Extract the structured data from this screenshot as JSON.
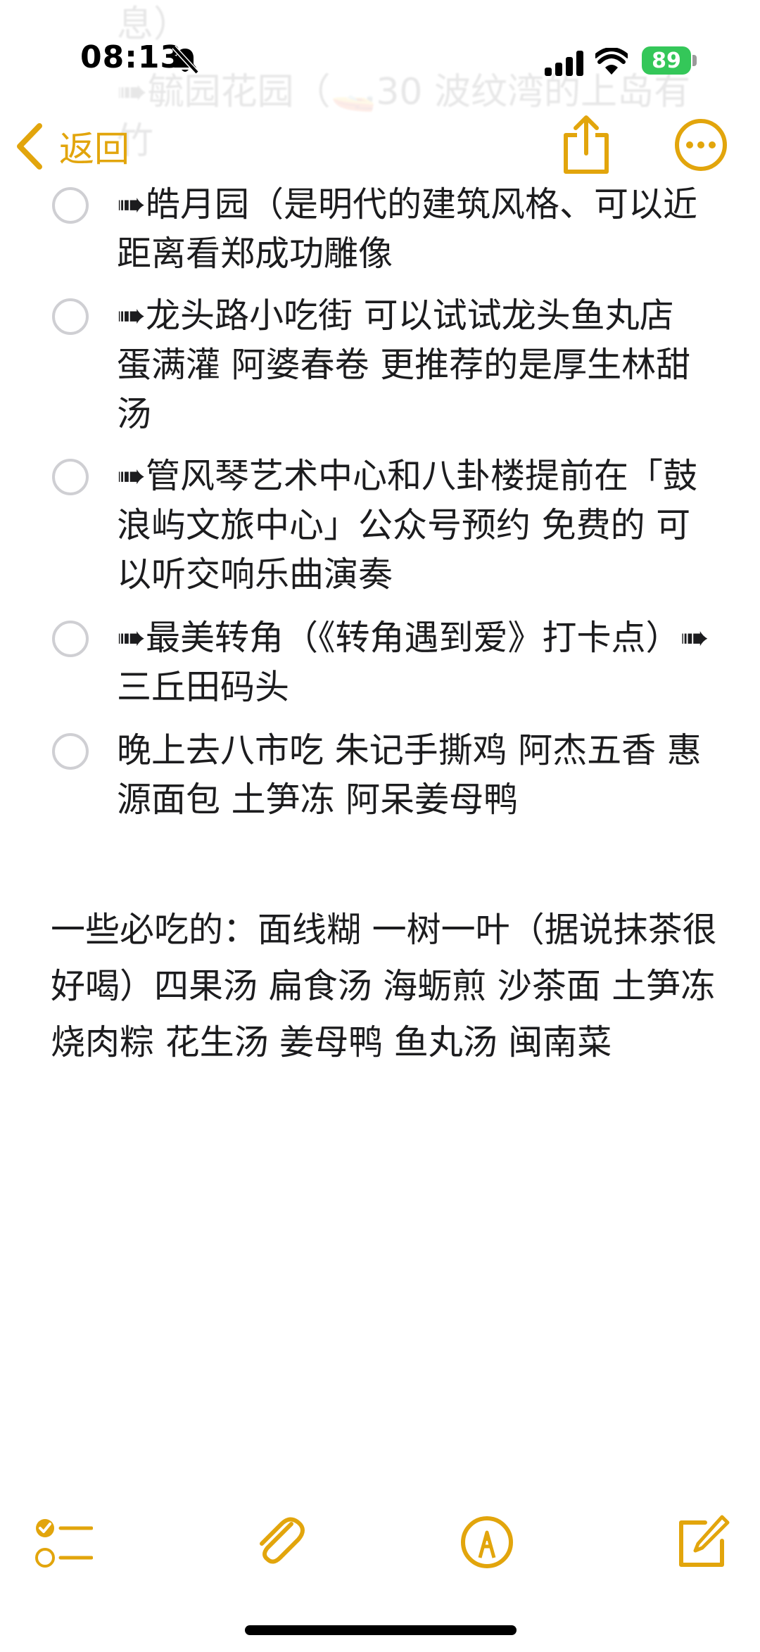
{
  "status_bar": {
    "time": "08:13",
    "battery": "89"
  },
  "faded_header": {
    "line1": "息）",
    "line2": "➠毓园花园（🚤30 波纹湾的上岛有",
    "line3": "竹"
  },
  "nav": {
    "back_label": "返回",
    "accent_color": "#e2a50c"
  },
  "checklist": [
    {
      "text": "➠皓月园（是明代的建筑风格、可以近距离看郑成功雕像",
      "checked": false
    },
    {
      "text": "➠龙头路小吃街 可以试试龙头鱼丸店 蛋满灌 阿婆春卷 更推荐的是厚生林甜汤",
      "checked": false
    },
    {
      "text": "➠管风琴艺术中心和八卦楼提前在「鼓浪屿文旅中心」公众号预约 免费的 可以听交响乐曲演奏",
      "checked": false
    },
    {
      "text": "➠最美转角（《转角遇到爱》打卡点）➠三丘田码头",
      "checked": false
    },
    {
      "text": "晚上去八市吃 朱记手撕鸡 阿杰五香 惠源面包 土笋冻 阿呆姜母鸭",
      "checked": false
    }
  ],
  "note_body": "一些必吃的：面线糊  一树一叶（据说抹茶很好喝）四果汤 扁食汤 海蛎煎  沙茶面  土笋冻 烧肉粽 花生汤 姜母鸭 鱼丸汤 闽南菜",
  "toolbar": {
    "icons": [
      "checklist-icon",
      "attachment-icon",
      "markup-icon",
      "compose-icon"
    ]
  }
}
